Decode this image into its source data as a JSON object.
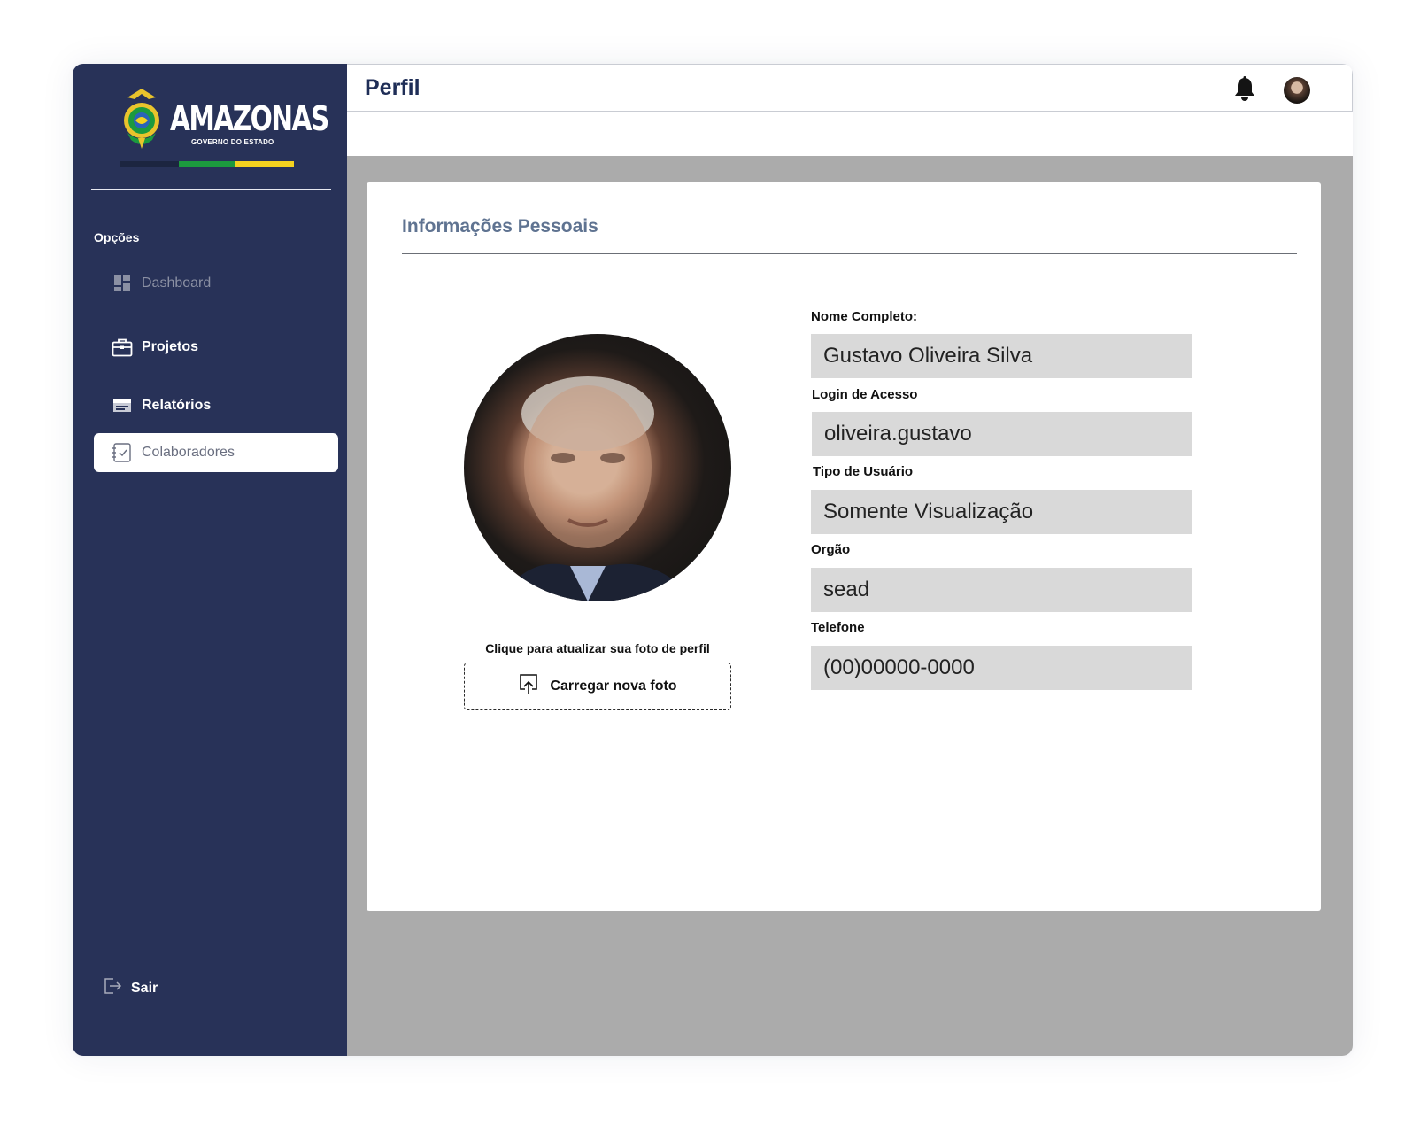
{
  "brand": {
    "name": "AMAZONAS",
    "subtitle": "GOVERNO DO ESTADO",
    "colors": {
      "navy": "#283258",
      "green": "#1c9a3e",
      "yellow": "#f4d21f",
      "dark": "#1c2540"
    }
  },
  "sidebar": {
    "section_label": "Opções",
    "items": [
      {
        "label": "Dashboard",
        "icon": "dashboard-icon",
        "state": "disabled"
      },
      {
        "label": "Projetos",
        "icon": "briefcase-icon",
        "state": "normal"
      },
      {
        "label": "Relatórios",
        "icon": "report-icon",
        "state": "normal"
      },
      {
        "label": "Colaboradores",
        "icon": "checklist-icon",
        "state": "active"
      }
    ],
    "logout_label": "Sair"
  },
  "header": {
    "title": "Perfil",
    "icons": [
      "bell-icon",
      "user-avatar"
    ]
  },
  "profile": {
    "section_title": "Informações Pessoais",
    "photo_hint": "Clique para atualizar sua foto de perfil",
    "upload_label": "Carregar nova foto",
    "fields": [
      {
        "label": "Nome Completo:",
        "value": "Gustavo Oliveira Silva"
      },
      {
        "label": "Login de Acesso",
        "value": "oliveira.gustavo"
      },
      {
        "label": "Tipo de Usuário",
        "value": "Somente Visualização"
      },
      {
        "label": "Orgão",
        "value": "sead"
      },
      {
        "label": "Telefone",
        "value": "(00)00000-0000"
      }
    ]
  }
}
